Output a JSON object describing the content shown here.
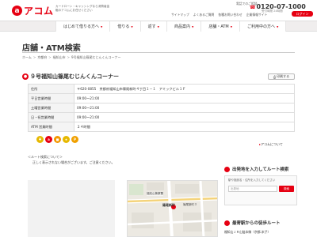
{
  "header": {
    "logo_mark": "a",
    "logo_text": "アコム",
    "tagline": "カードローン・キャッシングなら消費者金融のアコムにお任せください",
    "phone_label": "電話でのご相談",
    "phone": "0120-07-1000",
    "phone_sub": "受付時間 24時間",
    "util_links": [
      "サイトマップ",
      "よくあるご質問",
      "各種お問い合わせ",
      "企業情報サイト"
    ],
    "login_label": "ログイン"
  },
  "nav": {
    "items": [
      "はじめて借りる方へ",
      "借りる",
      "返す",
      "商品案内",
      "店舗・ATM",
      "ご利用中の方へ"
    ]
  },
  "page": {
    "title": "店舗・ATM検索",
    "breadcrumb": [
      "ホーム",
      "京都府",
      "福知山市",
      "9号福知山篠尾むじんくんコーナー"
    ]
  },
  "store": {
    "name": "９号福知山篠尾むじんくんコーナー",
    "print_label": "印刷する",
    "rows": [
      {
        "label": "住所",
        "value": "〒620-0855　京都府福知山市篠尾新町４丁目１－１　アミックビル１Ｆ"
      },
      {
        "label": "平日営業時間",
        "value": "09:00～21:00"
      },
      {
        "label": "土曜営業時間",
        "value": "09:00～21:00"
      },
      {
        "label": "日・祝営業時間",
        "value": "09:00～21:00"
      },
      {
        "label": "ATM 営業時間",
        "value": "２４時間"
      }
    ],
    "acom_link": "アコムについて"
  },
  "route": {
    "note": "＜ルート検索について＞",
    "sub": "正しく表示されない場合がございます。ご注意ください。"
  },
  "route_panel": {
    "title": "出発地を入力してルート検索",
    "hint": "駅や施設名・住所を入力してください",
    "placeholder": "出発地",
    "go_label": "検索",
    "title2": "最寄駅からの徒歩ルート",
    "station": "福知山ＪＲ山陰本線（京都-米子）"
  },
  "map": {
    "labels": [
      "福知山警察署",
      "篠尾新町",
      "篠尾新町３"
    ]
  }
}
